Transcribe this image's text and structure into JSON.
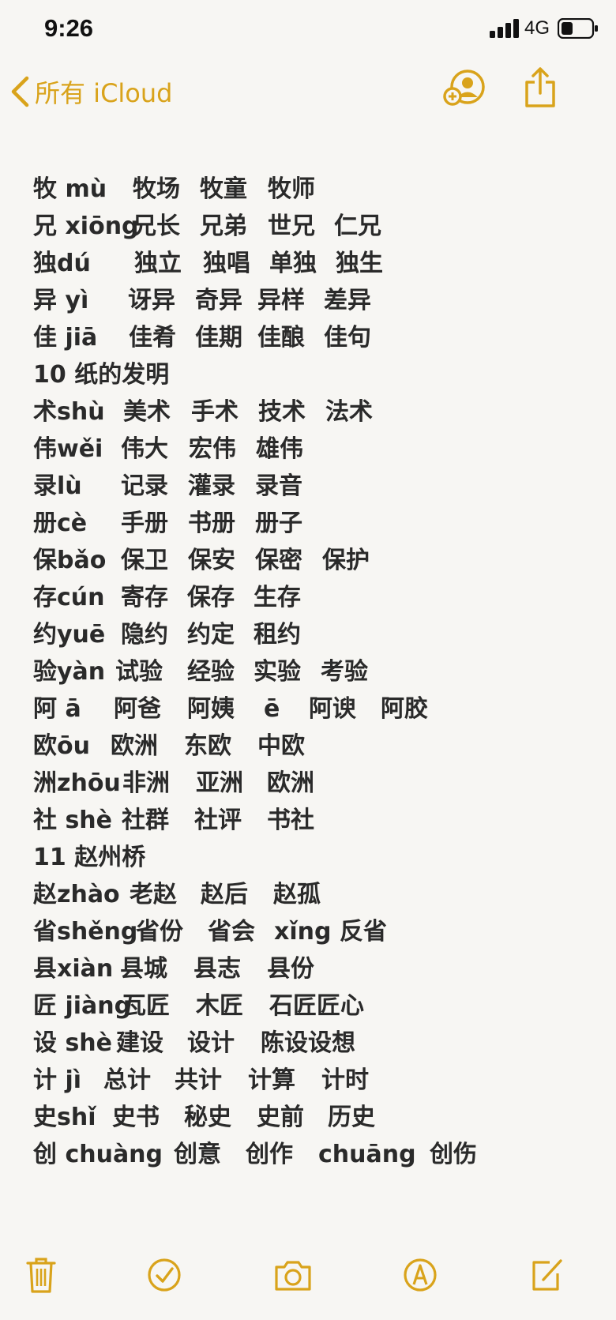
{
  "status_bar": {
    "time": "9:26",
    "network": "4G"
  },
  "nav": {
    "back_label": "所有 iCloud"
  },
  "colors": {
    "accent": "#d9a31b",
    "text": "#2a2a2a",
    "background": "#f7f6f3"
  },
  "note": {
    "rows": [
      [
        "牧 mù",
        "牧场",
        "牧童",
        "牧师"
      ],
      [
        "兄 xiōng",
        "兄长",
        "兄弟",
        "世兄",
        "仁兄"
      ],
      [
        "独dú",
        "独立",
        "独唱",
        "单独",
        "独生"
      ],
      [
        "异 yì",
        "讶异",
        "奇异",
        "异样",
        "差异"
      ],
      [
        "佳 jiā",
        "佳肴",
        "佳期",
        "佳酿",
        "佳句"
      ],
      [
        "10 纸的发明"
      ],
      [
        "术shù",
        "美术",
        "手术",
        "技术",
        "法术"
      ],
      [
        "伟wěi",
        "伟大",
        "宏伟",
        "雄伟"
      ],
      [
        "录lù",
        "记录",
        "灌录",
        "录音"
      ],
      [
        "册cè",
        "手册",
        "书册",
        "册子"
      ],
      [
        "保bǎo",
        "保卫",
        "保安",
        "保密",
        "保护"
      ],
      [
        "存cún",
        "寄存",
        "保存",
        "生存"
      ],
      [
        "约yuē",
        "隐约",
        "约定",
        "租约"
      ],
      [
        "验yàn",
        "试验",
        "经验",
        "实验",
        "考验"
      ],
      [
        "阿 ā",
        "阿爸",
        "阿姨",
        "ē",
        "阿谀",
        "阿胶"
      ],
      [
        "欧ōu",
        "欧洲",
        "东欧",
        "中欧"
      ],
      [
        "洲zhōu",
        "非洲",
        "亚洲",
        "欧洲"
      ],
      [
        "社 shè",
        "社群",
        "社评",
        "书社"
      ],
      [
        "11 赵州桥"
      ],
      [
        "赵zhào",
        "老赵",
        "赵后",
        "赵孤"
      ],
      [
        "省shěng",
        "省份",
        "省会",
        "xǐng",
        "反省"
      ],
      [
        "县xiàn",
        "县城",
        "县志",
        "县份"
      ],
      [
        "匠 jiàng",
        "瓦匠",
        "木匠",
        "石匠匠心"
      ],
      [
        "设 shè",
        "建设",
        "设计",
        "陈设设想"
      ],
      [
        "计 jì",
        "总计",
        "共计",
        "计算",
        "计时"
      ],
      [
        "史shǐ",
        "史书",
        "秘史",
        "史前",
        "历史"
      ],
      [
        "创 chuàng",
        "创意",
        "创作",
        "chuāng",
        "创伤"
      ]
    ]
  },
  "toolbar": {
    "icons": [
      "trash-icon",
      "checklist-icon",
      "camera-icon",
      "markup-icon",
      "compose-icon"
    ]
  }
}
